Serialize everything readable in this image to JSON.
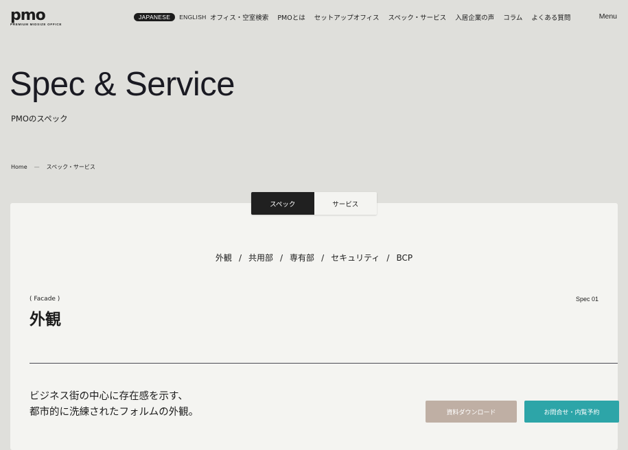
{
  "header": {
    "logo": {
      "mark": "pmo",
      "subtitle": "PREMIUM MIDSIZE OFFICE"
    },
    "languages": {
      "active": "JAPANESE",
      "other": "ENGLISH"
    },
    "nav": [
      "オフィス・空室検索",
      "PMOとは",
      "セットアップオフィス",
      "スペック・サービス",
      "入居企業の声",
      "コラム",
      "よくある質問"
    ],
    "menu_label": "Menu"
  },
  "hero": {
    "title": "Spec & Service",
    "subtitle": "PMOのスペック"
  },
  "breadcrumb": {
    "home": "Home",
    "separator": "—",
    "current": "スペック・サービス"
  },
  "tabs": {
    "spec": "スペック",
    "service": "サービス",
    "active": "spec"
  },
  "anchors": [
    "外観",
    "共用部",
    "専有部",
    "セキュリティ",
    "BCP"
  ],
  "anchor_separator": "/",
  "section": {
    "label_en": "( Facade )",
    "title": "外観",
    "number": "Spec 01",
    "lead_lines": [
      "ビジネス街の中心に存在感を示す、",
      "都市的に洗練されたフォルムの外観。"
    ]
  },
  "buttons": {
    "download": "資料ダウンロード",
    "contact": "お問合せ・内覧予約"
  },
  "colors": {
    "background": "#dfdfdb",
    "card": "#f4f4f1",
    "dark": "#202020",
    "download": "#bfafa4",
    "contact": "#2da5a8"
  }
}
